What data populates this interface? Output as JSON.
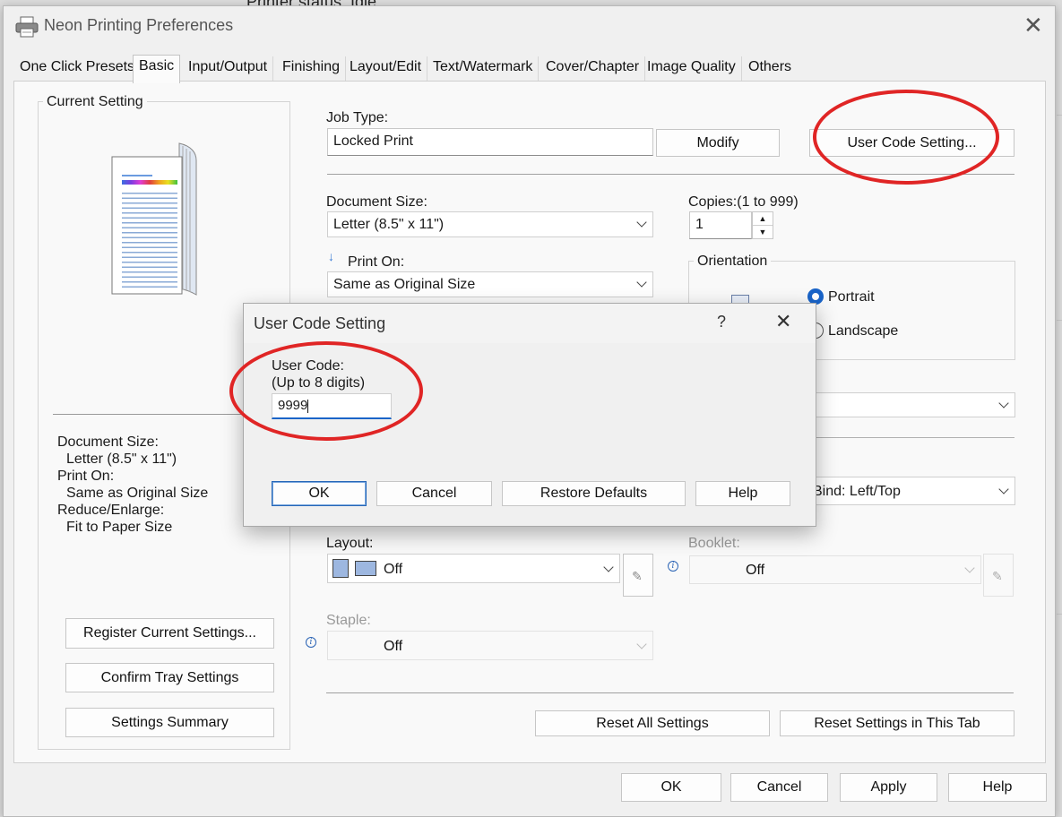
{
  "background": {
    "title": "Printer status:  Idle"
  },
  "window": {
    "title": "Neon Printing Preferences"
  },
  "tabs": [
    "One Click Presets",
    "Basic",
    "Input/Output",
    "Finishing",
    "Layout/Edit",
    "Text/Watermark",
    "Cover/Chapter",
    "Image Quality",
    "Others"
  ],
  "active_tab": "Basic",
  "left": {
    "current_setting_label": "Current Setting",
    "summary": {
      "document_size_label": "Document Size:",
      "document_size_value": "Letter (8.5\" x 11\")",
      "print_on_label": "Print On:",
      "print_on_value": "Same as Original Size",
      "reduce_label": "Reduce/Enlarge:",
      "reduce_value": "Fit to Paper Size"
    },
    "buttons": {
      "register": "Register Current Settings...",
      "confirm_tray": "Confirm Tray Settings",
      "summary": "Settings Summary"
    }
  },
  "main": {
    "job_type_label": "Job Type:",
    "job_type_value": "Locked Print",
    "modify_button": "Modify",
    "user_code_button": "User Code Setting...",
    "document_size_label": "Document Size:",
    "document_size_value": "Letter (8.5\" x 11\")",
    "copies_label": "Copies:(1 to 999)",
    "copies_value": "1",
    "print_on_label": "Print On:",
    "print_on_value": "Same as Original Size",
    "orientation_label": "Orientation",
    "portrait_label": "Portrait",
    "landscape_label": "Landscape",
    "bind_value": "Bind: Left/Top",
    "layout_label": "Layout:",
    "layout_value": "Off",
    "booklet_label": "Booklet:",
    "booklet_value": "Off",
    "staple_label": "Staple:",
    "staple_value": "Off",
    "reset_all_button": "Reset All Settings",
    "reset_tab_button": "Reset Settings in This Tab"
  },
  "footer": {
    "ok": "OK",
    "cancel": "Cancel",
    "apply": "Apply",
    "help": "Help"
  },
  "dialog": {
    "title": "User Code Setting",
    "help_glyph": "?",
    "user_code_label": "User Code:",
    "user_code_hint": "(Up to 8 digits)",
    "user_code_value": "9999",
    "ok": "OK",
    "cancel": "Cancel",
    "restore_defaults": "Restore Defaults",
    "help": "Help"
  },
  "colors": {
    "highlight_oval": "#e02525",
    "accent": "#1a64c8"
  }
}
